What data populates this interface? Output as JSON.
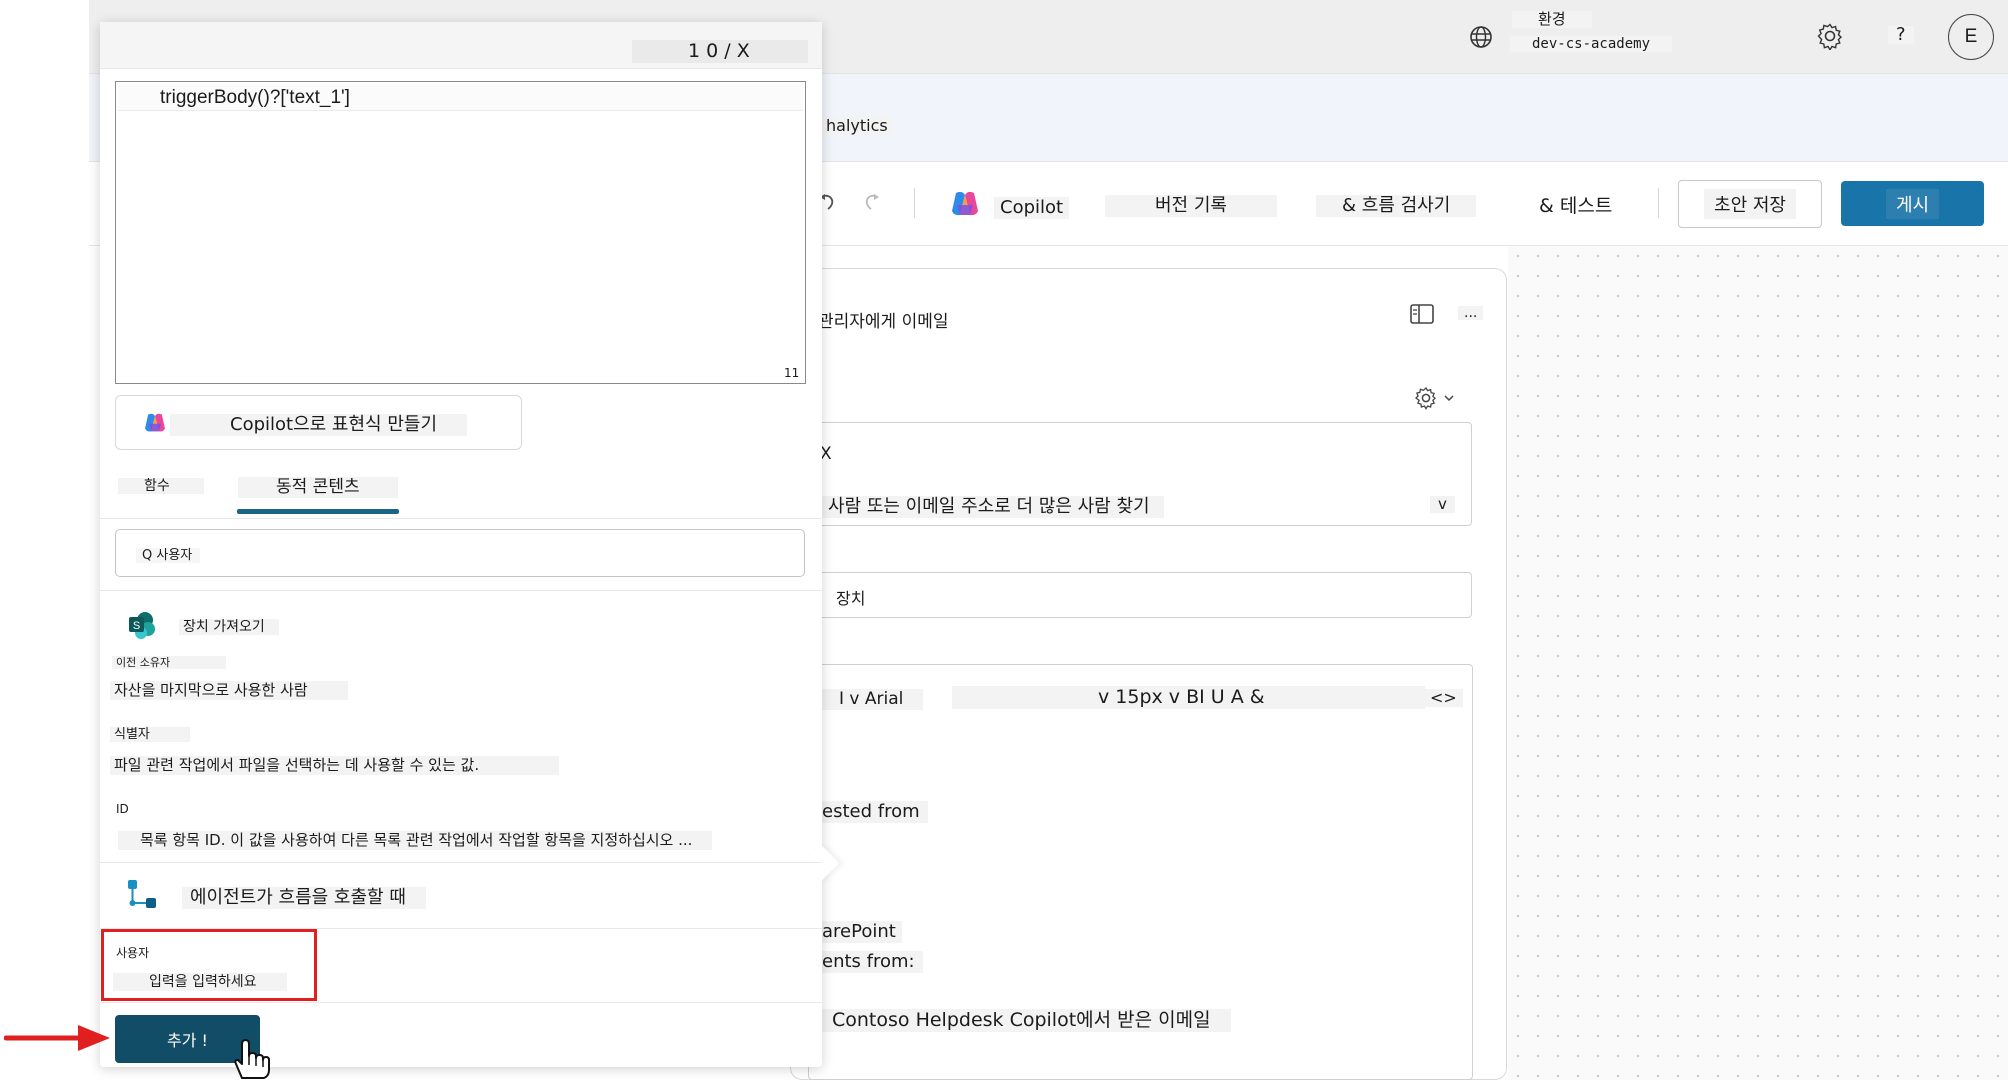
{
  "topbar": {
    "env_label": "환경",
    "env_name": "dev-cs-academy",
    "help": "?",
    "avatar_initial": "E"
  },
  "subheader": {
    "tab_fragment": "halytics"
  },
  "toolbar": {
    "copilot": "Copilot",
    "version_history": "버전 기록",
    "flow_checker": "& 흐름 검사기",
    "test": "& 테스트",
    "save_draft": "초안 저장",
    "publish": "게시"
  },
  "action_card": {
    "title": "관리자에게 이메일",
    "more": "...",
    "to_value": "X",
    "to_placeholder": "사람 또는 이메일 주소로 더 많은 사람 찾기",
    "to_chevron": "v",
    "subject_value": "장치",
    "editor_font": "I v Arial",
    "editor_tools": "v 15px v BI U A &",
    "editor_code": "<>",
    "body_line1": "ested from",
    "body_line2": "arePoint",
    "body_line3": "ents from:",
    "body_line4": "Contoso Helpdesk Copilot에서 받은 이메일"
  },
  "popup": {
    "counter": "1 0 / X",
    "expression": "triggerBody()?['text_1']",
    "char_count": "11",
    "copilot_expr_button": "Copilot으로 표현식 만들기",
    "tabs": [
      "함수",
      "동적 콘텐츠"
    ],
    "search_value": "Q 사용자",
    "group1_title": "장치 가져오기",
    "items": [
      {
        "name": "이전 소유자",
        "desc": "자산을 마지막으로 사용한 사람"
      },
      {
        "name": "식별자",
        "desc": "파일 관련 작업에서 파일을 선택하는 데 사용할 수 있는 값."
      },
      {
        "name": "ID",
        "desc": "목록 항목 ID. 이 값을 사용하여 다른 목록 관련 작업에서 작업할 항목을 지정하십시오 ..."
      }
    ],
    "group2_title": "에이전트가 흐름을 호출할 때",
    "user_label": "사용자",
    "user_placeholder": "입력을 입력하세요",
    "add_button": "추가 !"
  },
  "icons": [
    "globe-icon",
    "gear-icon",
    "undo-icon",
    "redo-icon",
    "copilot-logo-icon",
    "panel-icon",
    "settings-icon",
    "sharepoint-icon",
    "flow-trigger-icon",
    "red-arrow-icon",
    "hand-cursor-icon"
  ],
  "colors": {
    "publish": "#1874a9",
    "add_button": "#114d66",
    "tab_underline": "#1b6584",
    "highlight": "#e0201e"
  }
}
